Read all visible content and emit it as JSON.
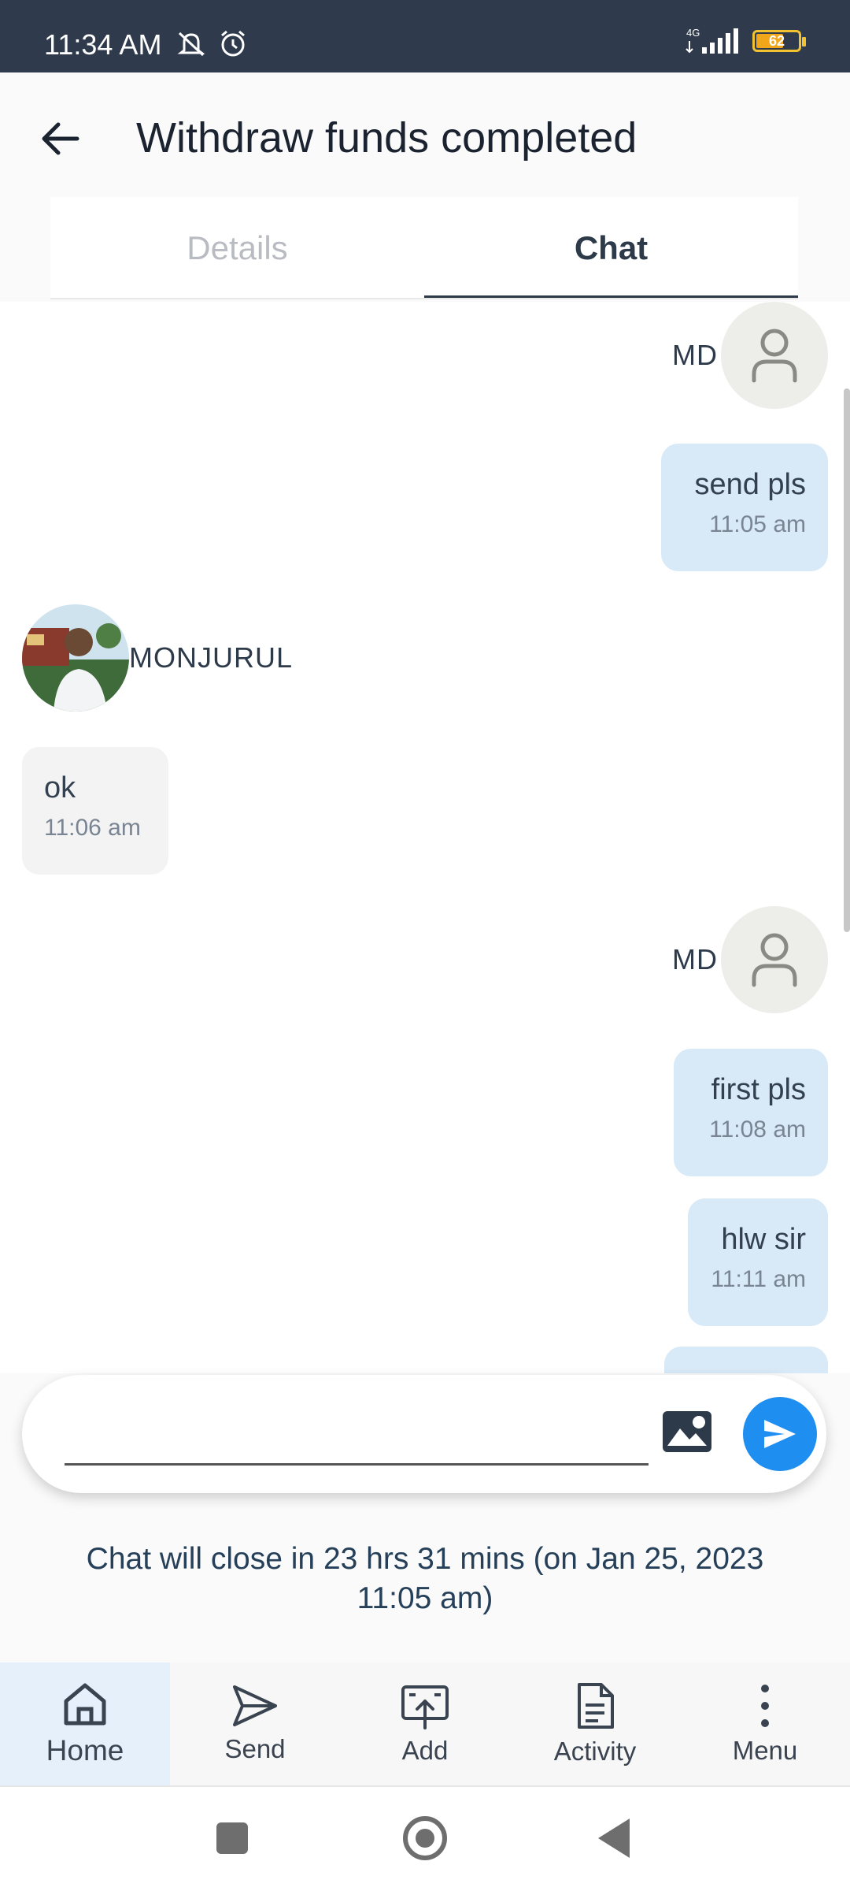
{
  "status_bar": {
    "time": "11:34 AM",
    "network": "4G",
    "battery": "62",
    "icons": [
      "mute-icon",
      "alarm-icon",
      "signal-icon",
      "battery-icon"
    ]
  },
  "app_bar": {
    "title": "Withdraw funds completed",
    "back_icon": "arrow-left-icon"
  },
  "tabs": [
    {
      "label": "Details",
      "active": false
    },
    {
      "label": "Chat",
      "active": true
    }
  ],
  "messages": [
    {
      "type": "sender",
      "side": "right",
      "name": "MD",
      "avatar": "user-icon"
    },
    {
      "type": "bubble",
      "side": "right",
      "text": "send pls",
      "time": "11:05 am"
    },
    {
      "type": "sender",
      "side": "left",
      "name": "MONJURUL",
      "avatar": "photo"
    },
    {
      "type": "bubble",
      "side": "left",
      "text": "ok",
      "time": "11:06 am"
    },
    {
      "type": "sender",
      "side": "right",
      "name": "MD",
      "avatar": "user-icon"
    },
    {
      "type": "bubble",
      "side": "right",
      "text": "first pls",
      "time": "11:08 am"
    },
    {
      "type": "bubble",
      "side": "right",
      "text": "hlw sir",
      "time": "11:11 am"
    }
  ],
  "input": {
    "placeholder": "",
    "image_icon": "image-icon",
    "send_icon": "send-icon"
  },
  "close_note": "Chat will close in 23 hrs 31 mins (on Jan 25, 2023 11:05 am)",
  "bottom_nav": [
    {
      "label": "Home",
      "icon": "home-icon",
      "active": true
    },
    {
      "label": "Send",
      "icon": "send-icon",
      "active": false
    },
    {
      "label": "Add",
      "icon": "add-funds-icon",
      "active": false
    },
    {
      "label": "Activity",
      "icon": "document-icon",
      "active": false
    },
    {
      "label": "Menu",
      "icon": "more-vertical-icon",
      "active": false
    }
  ],
  "colors": {
    "status_bar": "#2f3a4c",
    "outgoing_bubble": "#d8e9f7",
    "incoming_bubble": "#f3f3f3",
    "send_button": "#1f8ef1",
    "note_text": "#26405a",
    "nav_active_bg": "#e6f0fb"
  }
}
